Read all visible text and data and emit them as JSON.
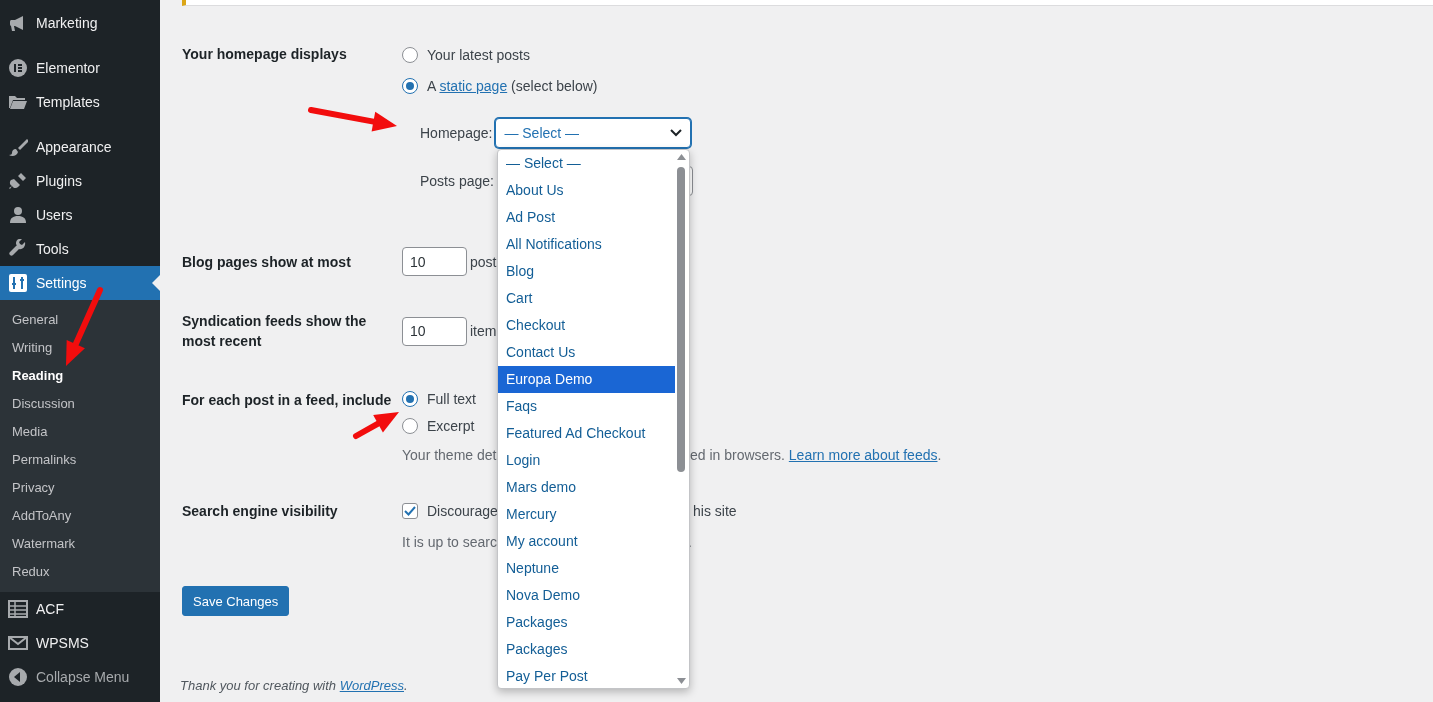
{
  "sidebar": {
    "groups": [
      [
        {
          "label": "Marketing",
          "selected": false
        }
      ],
      [
        {
          "label": "Elementor",
          "selected": false
        },
        {
          "label": "Templates",
          "selected": false
        }
      ],
      [
        {
          "label": "Appearance",
          "selected": false
        },
        {
          "label": "Plugins",
          "selected": false
        },
        {
          "label": "Users",
          "selected": false
        },
        {
          "label": "Tools",
          "selected": false
        },
        {
          "label": "Settings",
          "selected": true,
          "children": [
            {
              "label": "General",
              "selected": false
            },
            {
              "label": "Writing",
              "selected": false
            },
            {
              "label": "Reading",
              "selected": true
            },
            {
              "label": "Discussion",
              "selected": false
            },
            {
              "label": "Media",
              "selected": false
            },
            {
              "label": "Permalinks",
              "selected": false
            },
            {
              "label": "Privacy",
              "selected": false
            },
            {
              "label": "AddToAny",
              "selected": false
            },
            {
              "label": "Watermark",
              "selected": false
            },
            {
              "label": "Redux",
              "selected": false
            }
          ]
        },
        {
          "label": "ACF",
          "selected": false
        },
        {
          "label": "WPSMS",
          "selected": false
        },
        {
          "label": "Collapse Menu",
          "selected": false
        }
      ]
    ]
  },
  "homepage_displays": {
    "label": "Your homepage displays",
    "options": [
      {
        "label": "Your latest posts",
        "selected": false
      },
      {
        "prefix": "A",
        "link": "static page",
        "suffix": "(select below)",
        "selected": true
      }
    ]
  },
  "homepage_select": {
    "label": "Homepage:",
    "value": "— Select —"
  },
  "posts_page_select": {
    "label": "Posts page:"
  },
  "blog_pages": {
    "label": "Blog pages show at most",
    "value": "10",
    "unit": "post"
  },
  "syndication": {
    "label": "Syndication feeds show the most recent",
    "value": "10",
    "unit": "item"
  },
  "feed_include": {
    "label": "For each post in a feed, include",
    "options": [
      {
        "label": "Full text",
        "selected": true
      },
      {
        "label": "Excerpt",
        "selected": false
      }
    ],
    "note_start": "Your theme det",
    "note_end": "ed in browsers.",
    "link": "Learn more about feeds",
    "note_tail": "."
  },
  "search_visibility": {
    "label": "Search engine visibility",
    "checkbox": {
      "label_start": "Discourage",
      "label_end": "his site",
      "checked": true
    },
    "note_start": "It is up to searc",
    "note_end": "."
  },
  "save_button": "Save Changes",
  "footer": {
    "text": "Thank you for creating with",
    "link": "WordPress",
    "tail": "."
  },
  "dropdown": {
    "options": [
      {
        "label": "— Select —",
        "selected": false
      },
      {
        "label": "About Us",
        "selected": false
      },
      {
        "label": "Ad Post",
        "selected": false
      },
      {
        "label": "All Notifications",
        "selected": false
      },
      {
        "label": "Blog",
        "selected": false
      },
      {
        "label": "Cart",
        "selected": false
      },
      {
        "label": "Checkout",
        "selected": false
      },
      {
        "label": "Contact Us",
        "selected": false
      },
      {
        "label": "Europa Demo",
        "selected": true
      },
      {
        "label": "Faqs",
        "selected": false
      },
      {
        "label": "Featured Ad Checkout",
        "selected": false
      },
      {
        "label": "Login",
        "selected": false
      },
      {
        "label": "Mars demo",
        "selected": false
      },
      {
        "label": "Mercury",
        "selected": false
      },
      {
        "label": "My account",
        "selected": false
      },
      {
        "label": "Neptune",
        "selected": false
      },
      {
        "label": "Nova Demo",
        "selected": false
      },
      {
        "label": "Packages",
        "selected": false
      },
      {
        "label": "Packages",
        "selected": false
      },
      {
        "label": "Pay Per Post",
        "selected": false
      }
    ]
  }
}
